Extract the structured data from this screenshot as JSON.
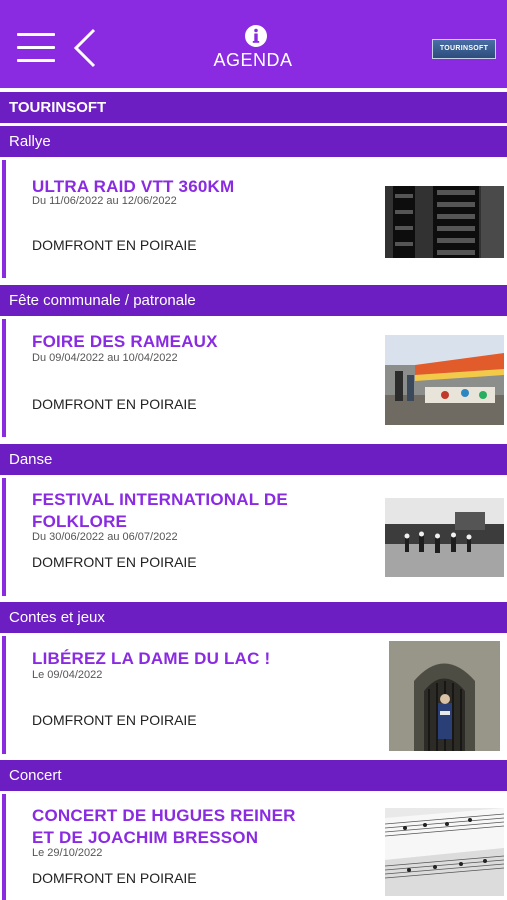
{
  "header": {
    "title": "AGENDA",
    "logo_text": "TOURINSOFT",
    "accent_color": "#8a2be2",
    "bar_color": "#6c1ec2"
  },
  "source_label": "TOURINSOFT",
  "events": [
    {
      "category": "Rallye",
      "title_line1": "ULTRA RAID VTT 360KM",
      "title_line2": "",
      "date": "Du 11/06/2022 au 12/06/2022",
      "place": "DOMFRONT EN POIRAIE",
      "image": "bike-tire-photo"
    },
    {
      "category": "Fête communale / patronale",
      "title_line1": "FOIRE DES RAMEAUX",
      "title_line2": "",
      "date": "Du 09/04/2022 au 10/04/2022",
      "place": "DOMFRONT EN POIRAIE",
      "image": "market-stalls-photo"
    },
    {
      "category": "Danse",
      "title_line1": "FESTIVAL INTERNATIONAL DE",
      "title_line2": "FOLKLORE",
      "date": "Du 30/06/2022 au 06/07/2022",
      "place": "DOMFRONT EN POIRAIE",
      "image": "folk-dancers-photo"
    },
    {
      "category": "Contes et jeux",
      "title_line1": "LIBÉREZ LA DAME DU LAC !",
      "title_line2": "",
      "date": "Le 09/04/2022",
      "place": "DOMFRONT EN POIRAIE",
      "image": "stone-doorway-photo"
    },
    {
      "category": "Concert",
      "title_line1": "CONCERT DE HUGUES REINER",
      "title_line2": "ET DE JOACHIM BRESSON",
      "date": "Le 29/10/2022",
      "place": "DOMFRONT EN POIRAIE",
      "image": "sheet-music-photo"
    }
  ]
}
